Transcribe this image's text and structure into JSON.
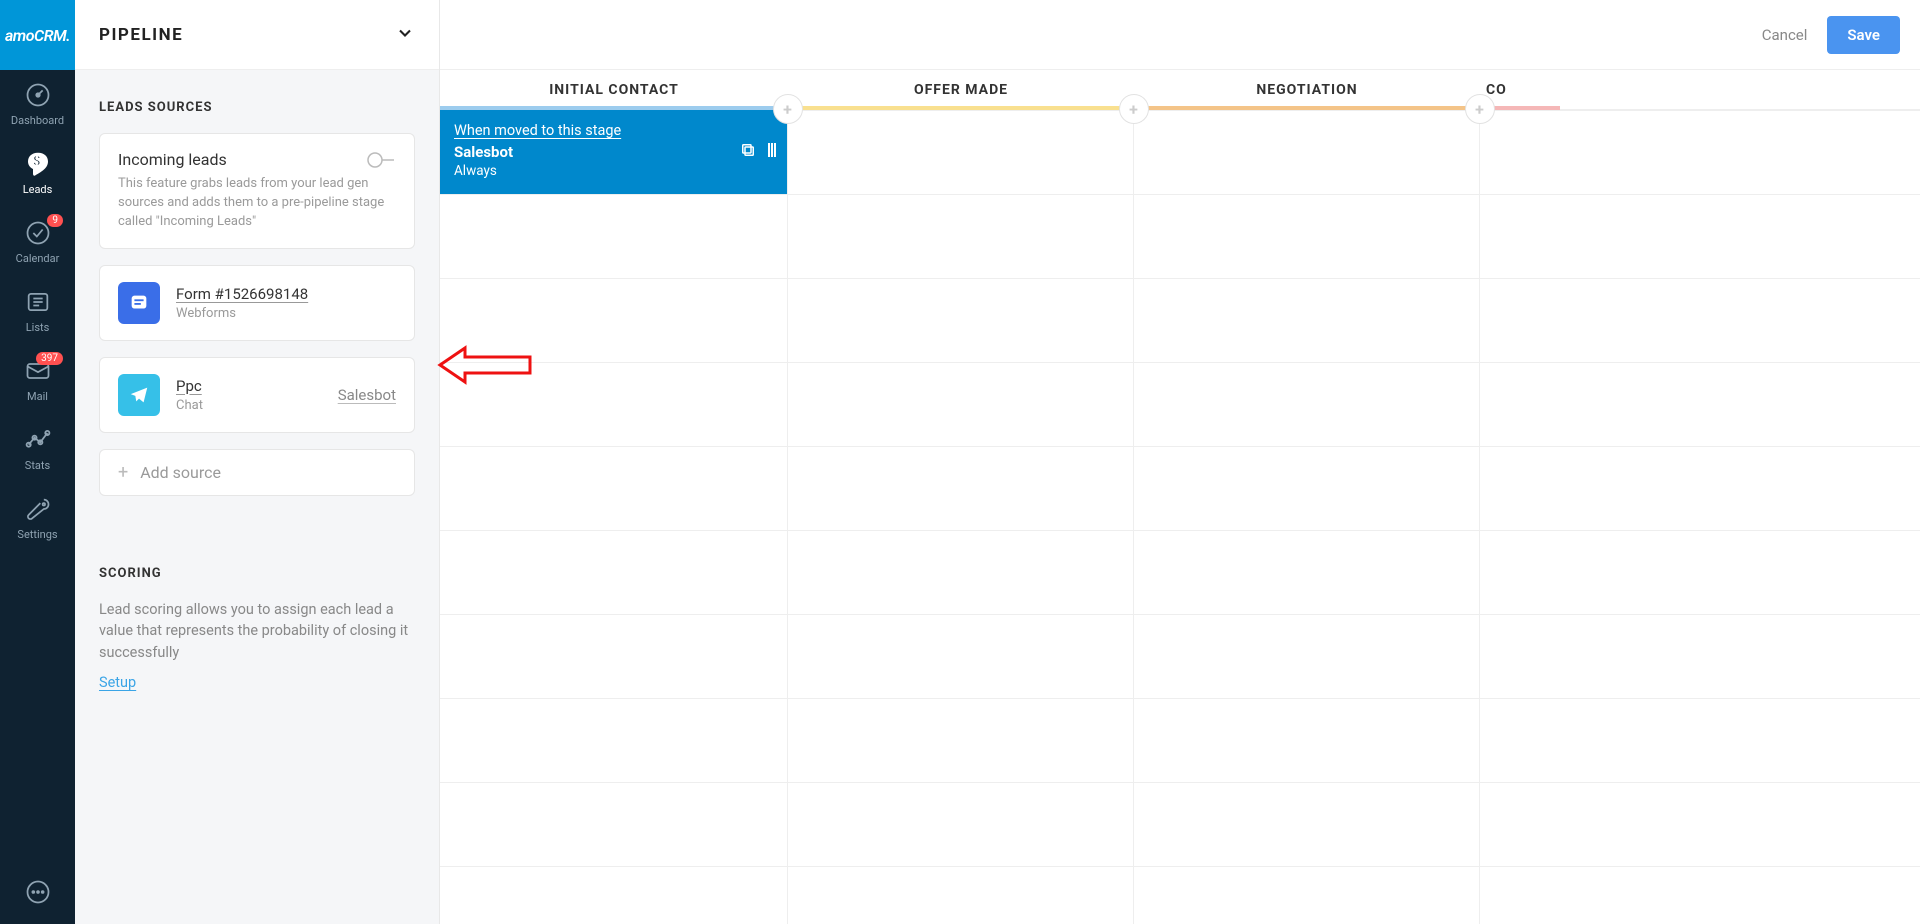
{
  "logo": "amoCRM.",
  "nav": {
    "dashboard": "Dashboard",
    "leads": "Leads",
    "calendar": "Calendar",
    "calendar_badge": "9",
    "lists": "Lists",
    "mail": "Mail",
    "mail_badge": "397",
    "stats": "Stats",
    "settings": "Settings"
  },
  "left": {
    "header": "PIPELINE",
    "sources_title": "LEADS SOURCES",
    "incoming_title": "Incoming leads",
    "incoming_desc": "This feature grabs leads from your lead gen sources and adds them to a pre-pipeline stage called \"Incoming Leads\"",
    "source1_title": "Form #1526698148",
    "source1_sub": "Webforms",
    "source2_title": "Ppc",
    "source2_sub": "Chat",
    "source2_right": "Salesbot",
    "add_source": "Add source",
    "scoring_title": "SCORING",
    "scoring_desc": "Lead scoring allows you to assign each lead a value that represents the probability of closing it successfully",
    "setup": "Setup"
  },
  "top": {
    "cancel": "Cancel",
    "save": "Save"
  },
  "stages": {
    "s0": "INITIAL CONTACT",
    "s1": "OFFER MADE",
    "s2": "NEGOTIATION",
    "s3": "CO"
  },
  "trigger": {
    "link": "When moved to this stage",
    "title": "Salesbot",
    "sub": "Always"
  }
}
